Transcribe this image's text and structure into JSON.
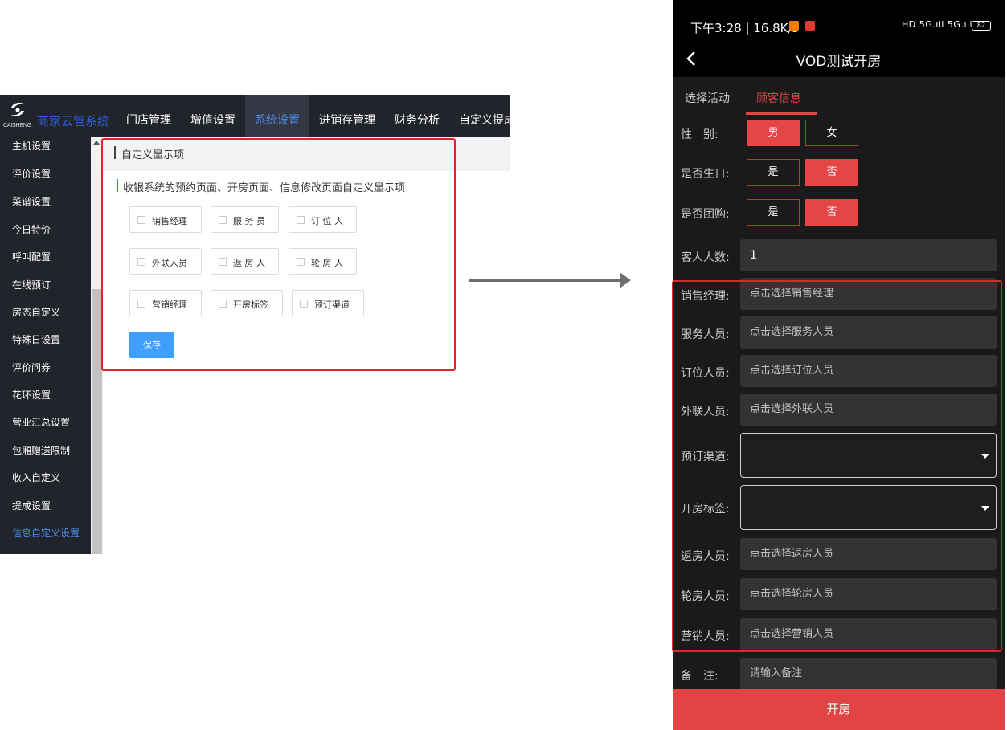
{
  "admin": {
    "logo_sub": "CAISHENG",
    "brand": "商家云管系统",
    "menu": [
      {
        "label": "门店管理"
      },
      {
        "label": "增值设置"
      },
      {
        "label": "系统设置"
      },
      {
        "label": "进销存管理"
      },
      {
        "label": "财务分析"
      },
      {
        "label": "自定义提成"
      }
    ],
    "active_menu": "系统设置",
    "sidebar": [
      {
        "label": "主机设置"
      },
      {
        "label": "评价设置"
      },
      {
        "label": "菜谱设置"
      },
      {
        "label": "今日特价"
      },
      {
        "label": "呼叫配置"
      },
      {
        "label": "在线预订"
      },
      {
        "label": "房态自定义"
      },
      {
        "label": "特殊日设置"
      },
      {
        "label": "评价问券"
      },
      {
        "label": "花环设置"
      },
      {
        "label": "营业汇总设置"
      },
      {
        "label": "包厢赠送限制"
      },
      {
        "label": "收入自定义"
      },
      {
        "label": "提成设置"
      },
      {
        "label": "信息自定义设置"
      }
    ],
    "active_sidebar": "信息自定义设置",
    "section_title": "自定义显示项",
    "description": "收银系统的预约页面、开房页面、信息修改页面自定义显示项",
    "checkboxes": [
      {
        "label": "销售经理",
        "checked": false
      },
      {
        "label": "服 务 员",
        "checked": false
      },
      {
        "label": "订 位 人",
        "checked": false
      },
      {
        "label": "外联人员",
        "checked": false
      },
      {
        "label": "返 房 人",
        "checked": false
      },
      {
        "label": "轮 房 人",
        "checked": false
      },
      {
        "label": "营销经理",
        "checked": false
      },
      {
        "label": "开房标签",
        "checked": false
      },
      {
        "label": "预订渠道",
        "checked": false
      }
    ],
    "save_label": "保存"
  },
  "phone": {
    "status": {
      "time": "下午3:28 | 16.8K/s",
      "signal": "HD 5G.ıll 5G.ıll",
      "battery": "82"
    },
    "title": "VOD测试开房",
    "tabs": [
      {
        "label": "选择活动"
      },
      {
        "label": "顾客信息"
      }
    ],
    "active_tab": "顾客信息",
    "gender": {
      "label": "性　别:",
      "options": [
        "男",
        "女"
      ],
      "selected": "男"
    },
    "birthday": {
      "label": "是否生日:",
      "options": [
        "是",
        "否"
      ],
      "selected": "否"
    },
    "group": {
      "label": "是否团购:",
      "options": [
        "是",
        "否"
      ],
      "selected": "否"
    },
    "guests": {
      "label": "客人人数:",
      "value": "1"
    },
    "fields": [
      {
        "label": "销售经理:",
        "placeholder": "点击选择销售经理"
      },
      {
        "label": "服务人员:",
        "placeholder": "点击选择服务人员"
      },
      {
        "label": "订位人员:",
        "placeholder": "点击选择订位人员"
      },
      {
        "label": "外联人员:",
        "placeholder": "点击选择外联人员"
      }
    ],
    "selects": [
      {
        "label": "预订渠道:",
        "value": ""
      },
      {
        "label": "开房标签:",
        "value": ""
      }
    ],
    "fields2": [
      {
        "label": "返房人员:",
        "placeholder": "点击选择返房人员"
      },
      {
        "label": "轮房人员:",
        "placeholder": "点击选择轮房人员"
      },
      {
        "label": "营销人员:",
        "placeholder": "点击选择营销人员"
      }
    ],
    "remark": {
      "label": "备　注:",
      "placeholder": "请输入备注"
    },
    "submit_label": "开房"
  },
  "colors": {
    "accent_red": "#e64545",
    "admin_blue": "#409eff",
    "highlight_box": "#e0252a"
  }
}
